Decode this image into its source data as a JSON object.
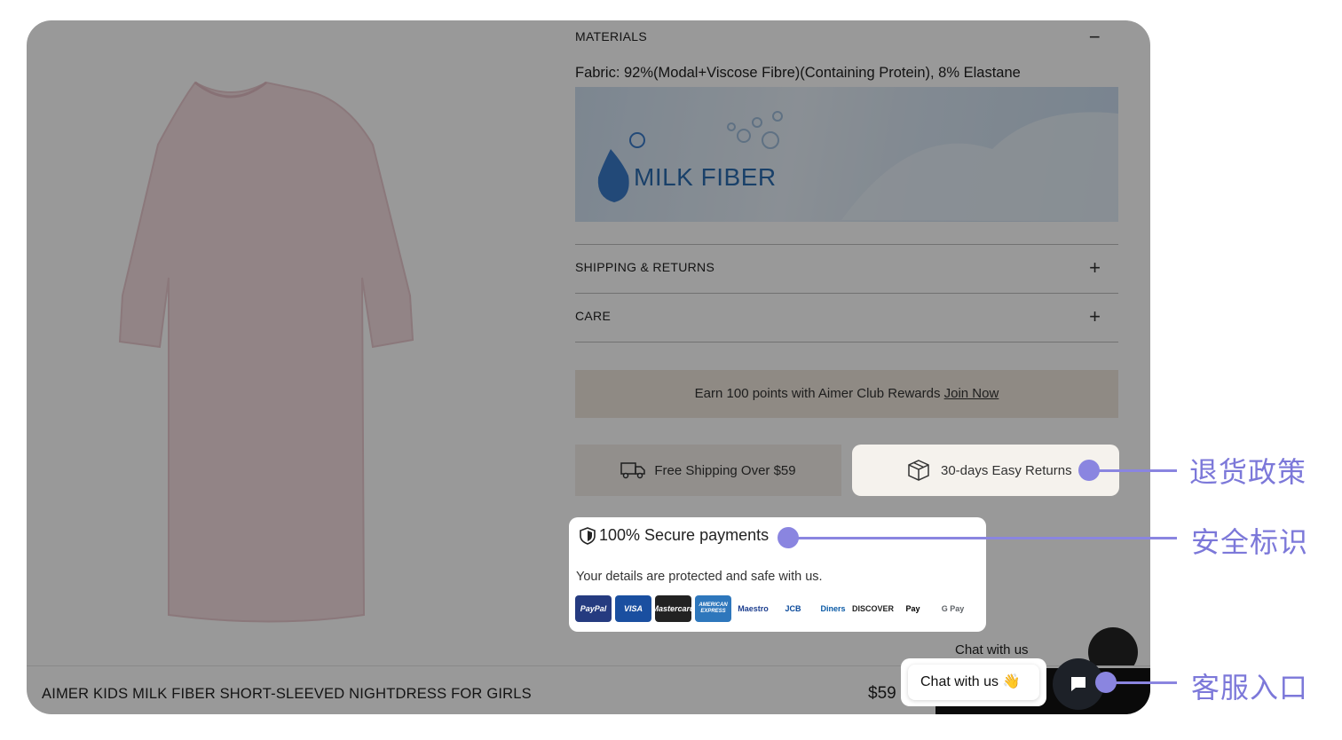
{
  "materials": {
    "header": "MATERIALS",
    "toggle": "−",
    "fabric": "Fabric: 92%(Modal+Viscose Fibre)(Containing Protein), 8% Elastane",
    "banner_brand": "MILK FIBER"
  },
  "accordion": [
    {
      "label": "SHIPPING & RETURNS",
      "toggle": "+"
    },
    {
      "label": "CARE",
      "toggle": "+"
    }
  ],
  "rewards": {
    "text": "Earn 100 points with Aimer Club Rewards ",
    "link": "Join Now"
  },
  "perks": {
    "shipping": "Free Shipping Over $59",
    "returns": "30-days Easy Returns"
  },
  "secure": {
    "title": "100% Secure payments",
    "subtitle": "Your details are protected and safe with us.",
    "payments": [
      {
        "name": "PayPal",
        "bg": "#253b80",
        "fg": "#ffffff"
      },
      {
        "name": "VISA",
        "bg": "#1a4fa0",
        "fg": "#ffffff"
      },
      {
        "name": "Mastercard",
        "bg": "#222222",
        "fg": "#ffffff"
      },
      {
        "name": "AMERICAN EXPRESS",
        "bg": "#2e77bc",
        "fg": "#ffffff"
      },
      {
        "name": "Maestro",
        "bg": "#ffffff",
        "fg": "#1d3e8f"
      },
      {
        "name": "JCB",
        "bg": "#ffffff",
        "fg": "#0b4a9b"
      },
      {
        "name": "Diners",
        "bg": "#ffffff",
        "fg": "#0a5aa6"
      },
      {
        "name": "DISCOVER",
        "bg": "#ffffff",
        "fg": "#222222"
      },
      {
        "name": "Pay",
        "bg": "#ffffff",
        "fg": "#000000"
      },
      {
        "name": "G Pay",
        "bg": "#ffffff",
        "fg": "#5f6368"
      }
    ]
  },
  "chat": {
    "label": "Chat with us",
    "emoji": "👋"
  },
  "bottom_bar": {
    "title": "AIMER KIDS MILK FIBER SHORT-SLEEVED NIGHTDRESS FOR GIRLS",
    "price": "$59"
  },
  "callouts": {
    "returns": "退货政策",
    "secure": "安全标识",
    "chat": "客服入口"
  },
  "colors": {
    "accent": "#8a85e0",
    "overlay": "rgba(0,0,0,0.40)"
  }
}
